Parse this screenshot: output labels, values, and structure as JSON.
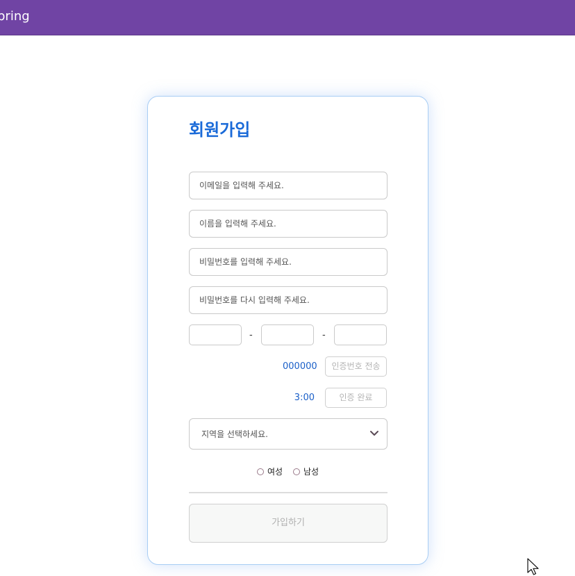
{
  "header": {
    "brand": "pring",
    "color": "#7044a4"
  },
  "signup": {
    "title": "회원가입",
    "email_placeholder": "이메일을 입력해 주세요.",
    "name_placeholder": "이름을 입력해 주세요.",
    "password_placeholder": "비밀번호를 입력해 주세요.",
    "password_confirm_placeholder": "비밀번호를 다시 입력해 주세요.",
    "phone": {
      "part1": "",
      "part2": "",
      "part3": "",
      "separator": "-"
    },
    "verification_code": "000000",
    "send_code_label": "인증번호 전송",
    "timer": "3:00",
    "verify_label": "인증 완료",
    "region": {
      "selected": "지역을 선택하세요."
    },
    "gender": {
      "female": "여성",
      "male": "남성"
    },
    "submit_label": "가입하기",
    "accent_color": "#1a6ad8"
  }
}
